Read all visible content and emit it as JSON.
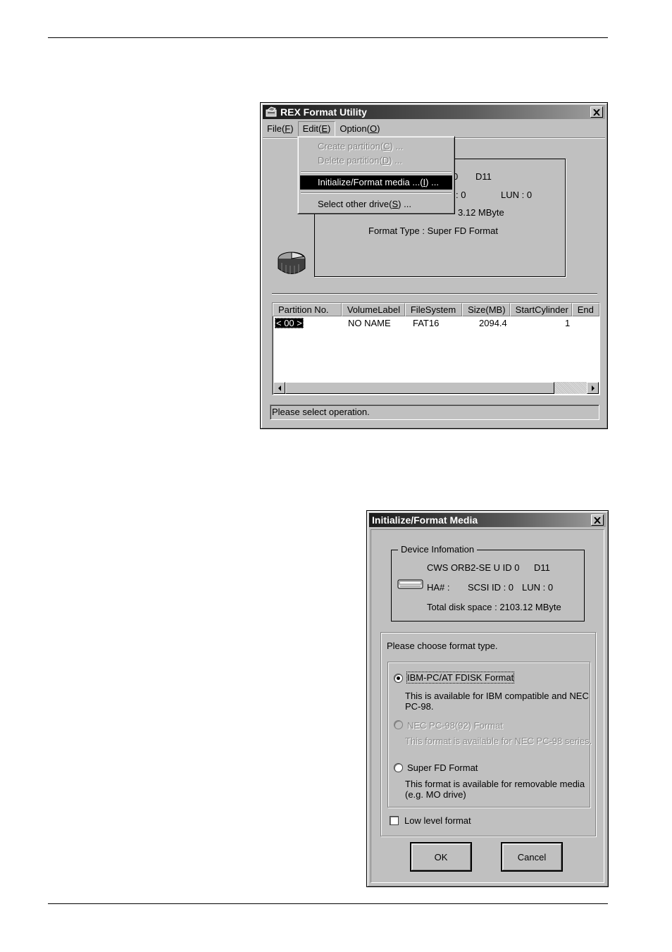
{
  "main_window": {
    "title": "REX Format Utility",
    "menu": {
      "file": {
        "text": "File(",
        "key": "F",
        "end": ")"
      },
      "edit": {
        "text": "Edit(",
        "key": "E",
        "end": ")"
      },
      "option": {
        "text": "Option(",
        "key": "O",
        "end": ")"
      }
    },
    "edit_menu": {
      "create_partition": {
        "text": "Create partition(",
        "key": "C",
        "end": ") ..."
      },
      "delete_partition": {
        "text": "Delete partition(",
        "key": "D",
        "end": ") ..."
      },
      "initialize_format": {
        "text": "Initialize/Format media ...(",
        "key": "I",
        "end": ") ..."
      },
      "select_drive": {
        "text": "Select other drive(",
        "key": "S",
        "end": ") ..."
      }
    },
    "device_info": {
      "line1a": "0",
      "line1b": "D11",
      "line2a": ": 0",
      "line2b": "LUN : 0",
      "line3": "3.12 MByte",
      "line4": "Format Type : Super FD Format"
    },
    "table": {
      "columns": [
        "Partition No.",
        "VolumeLabel",
        "FileSystem",
        "Size(MB)",
        "StartCylinder",
        "End"
      ],
      "rows": [
        {
          "partition": "< 00 >",
          "label": "NO NAME",
          "fs": "FAT16",
          "size": "2094.4",
          "start": "1"
        }
      ]
    },
    "status": "Please select operation."
  },
  "dialog": {
    "title": "Initialize/Format Media",
    "device_info_title": "Device Infomation",
    "device_line1a": "CWS ORB2-SE U ID 0",
    "device_line1b": "D11",
    "device_line2a": "HA# :",
    "device_line2b": "SCSI ID : 0",
    "device_line2c": "LUN : 0",
    "device_line3": "Total disk space : 2103.12 MByte",
    "choose_prompt": "Please choose format type.",
    "options": [
      {
        "label": "IBM-PC/AT  FDISK Format",
        "desc": "This is available for IBM compatible and NEC PC-98.",
        "checked": true,
        "enabled": true
      },
      {
        "label": "NEC PC-98(92) Format",
        "desc": "This format is available for NEC PC-98 series.",
        "checked": false,
        "enabled": false
      },
      {
        "label": "Super FD Format",
        "desc": "This format is available for removable media (e.g. MO drive)",
        "checked": false,
        "enabled": true
      }
    ],
    "low_level_label": "Low level format",
    "low_level_checked": false,
    "ok_label": "OK",
    "cancel_label": "Cancel"
  }
}
